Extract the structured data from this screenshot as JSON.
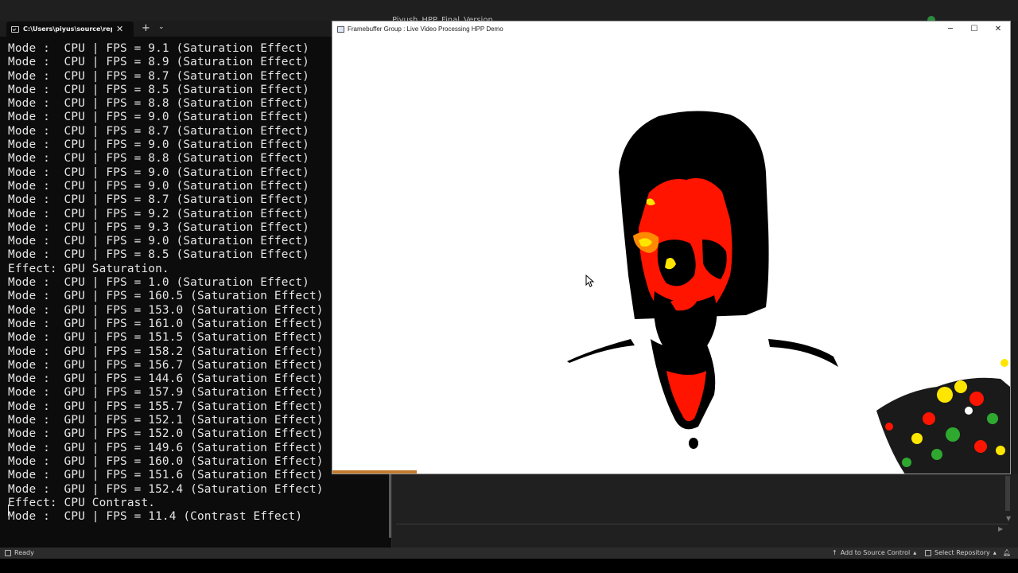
{
  "ide": {
    "background_title": "Piyush_HPP_Final_Version",
    "status_ready": "Ready",
    "add_to_source_control": "Add to Source Control",
    "select_repository": "Select Repository"
  },
  "terminal": {
    "tab_title": "C:\\Users\\piyus\\source\\repos\\",
    "lines": [
      "Mode :  CPU | FPS = 9.1 (Saturation Effect)",
      "Mode :  CPU | FPS = 8.9 (Saturation Effect)",
      "Mode :  CPU | FPS = 8.7 (Saturation Effect)",
      "Mode :  CPU | FPS = 8.5 (Saturation Effect)",
      "Mode :  CPU | FPS = 8.8 (Saturation Effect)",
      "Mode :  CPU | FPS = 9.0 (Saturation Effect)",
      "Mode :  CPU | FPS = 8.7 (Saturation Effect)",
      "Mode :  CPU | FPS = 9.0 (Saturation Effect)",
      "Mode :  CPU | FPS = 8.8 (Saturation Effect)",
      "Mode :  CPU | FPS = 9.0 (Saturation Effect)",
      "Mode :  CPU | FPS = 9.0 (Saturation Effect)",
      "Mode :  CPU | FPS = 8.7 (Saturation Effect)",
      "Mode :  CPU | FPS = 9.2 (Saturation Effect)",
      "Mode :  CPU | FPS = 9.3 (Saturation Effect)",
      "Mode :  CPU | FPS = 9.0 (Saturation Effect)",
      "Mode :  CPU | FPS = 8.5 (Saturation Effect)",
      "Effect: GPU Saturation.",
      "Mode :  CPU | FPS = 1.0 (Saturation Effect)",
      "Mode :  GPU | FPS = 160.5 (Saturation Effect)",
      "Mode :  GPU | FPS = 153.0 (Saturation Effect)",
      "Mode :  GPU | FPS = 161.0 (Saturation Effect)",
      "Mode :  GPU | FPS = 151.5 (Saturation Effect)",
      "Mode :  GPU | FPS = 158.2 (Saturation Effect)",
      "Mode :  GPU | FPS = 156.7 (Saturation Effect)",
      "Mode :  GPU | FPS = 144.6 (Saturation Effect)",
      "Mode :  GPU | FPS = 157.9 (Saturation Effect)",
      "Mode :  GPU | FPS = 155.7 (Saturation Effect)",
      "Mode :  GPU | FPS = 152.1 (Saturation Effect)",
      "Mode :  GPU | FPS = 152.0 (Saturation Effect)",
      "Mode :  GPU | FPS = 149.6 (Saturation Effect)",
      "Mode :  GPU | FPS = 160.0 (Saturation Effect)",
      "Mode :  GPU | FPS = 151.6 (Saturation Effect)",
      "Mode :  GPU | FPS = 152.4 (Saturation Effect)",
      "Effect: CPU Contrast.",
      "Mode :  CPU | FPS = 11.4 (Contrast Effect)"
    ]
  },
  "framebuffer": {
    "window_title": "Framebuffer Group : Live Video Processing HPP Demo",
    "video_description": "Live webcam frame with saturation/contrast effect applied"
  },
  "icons": {
    "terminal_tab": "terminal-icon",
    "close": "close-icon",
    "new_tab": "plus-icon",
    "dropdown": "chevron-down-icon",
    "minimize": "minimize-icon",
    "maximize": "maximize-icon",
    "window_close": "close-icon",
    "cursor": "mouse-pointer-icon"
  },
  "colors": {
    "terminal_bg": "#0c0c0c",
    "terminal_text": "#e6e6e6",
    "effect_red": "#ff1a00",
    "effect_yellow": "#ffe600"
  }
}
